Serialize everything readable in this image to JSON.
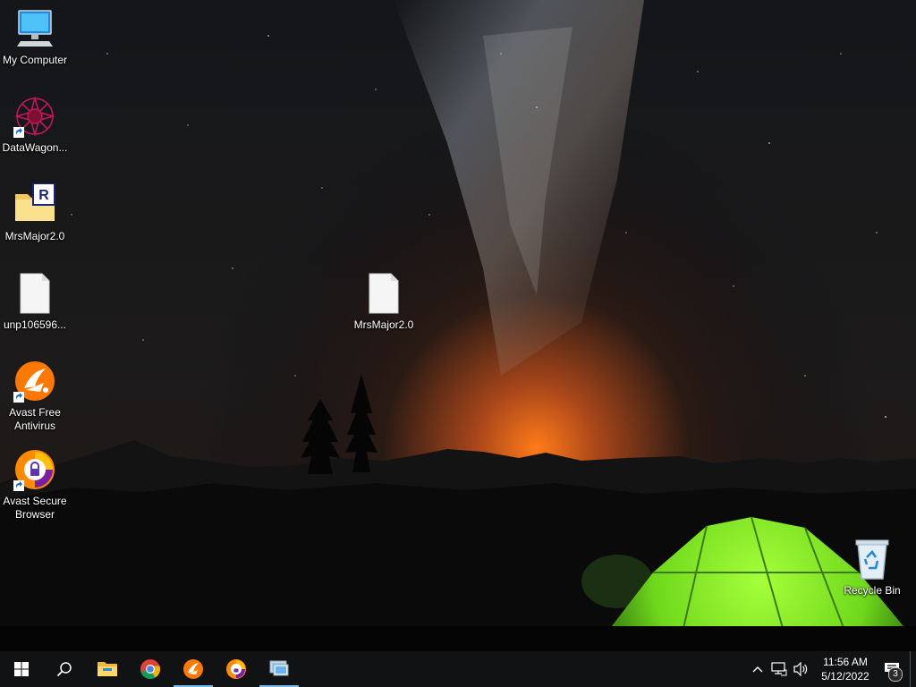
{
  "desktop": {
    "icons": [
      {
        "label": "My Computer",
        "icon": "computer-icon"
      },
      {
        "label": "DataWagon...",
        "icon": "datawagon-icon"
      },
      {
        "label": "MrsMajor2.0",
        "icon": "archive-folder-icon"
      },
      {
        "label": "unp106596...",
        "icon": "file-icon"
      },
      {
        "label": "Avast Free Antivirus",
        "icon": "avast-antivirus-icon"
      },
      {
        "label": "Avast Secure Browser",
        "icon": "avast-browser-icon"
      },
      {
        "label": "MrsMajor2.0",
        "icon": "file-icon"
      },
      {
        "label": "Recycle Bin",
        "icon": "recycle-bin-icon"
      }
    ]
  },
  "taskbar": {
    "buttons": [
      {
        "icon": "windows-start-icon"
      },
      {
        "icon": "search-icon"
      },
      {
        "icon": "file-explorer-icon"
      },
      {
        "icon": "chrome-icon"
      },
      {
        "icon": "avast-antivirus-icon"
      },
      {
        "icon": "avast-browser-icon"
      },
      {
        "icon": "remote-desktop-icon"
      }
    ],
    "tray": {
      "icons": [
        "chevron-up-icon",
        "network-icon",
        "volume-icon"
      ],
      "time": "11:56 AM",
      "date": "5/12/2022",
      "notification_count": "3"
    }
  },
  "colors": {
    "taskbar_bg": "#101214",
    "active_indicator": "#76b9ed",
    "avast_orange": "#ff7800",
    "tent_green": "#7ed321"
  }
}
